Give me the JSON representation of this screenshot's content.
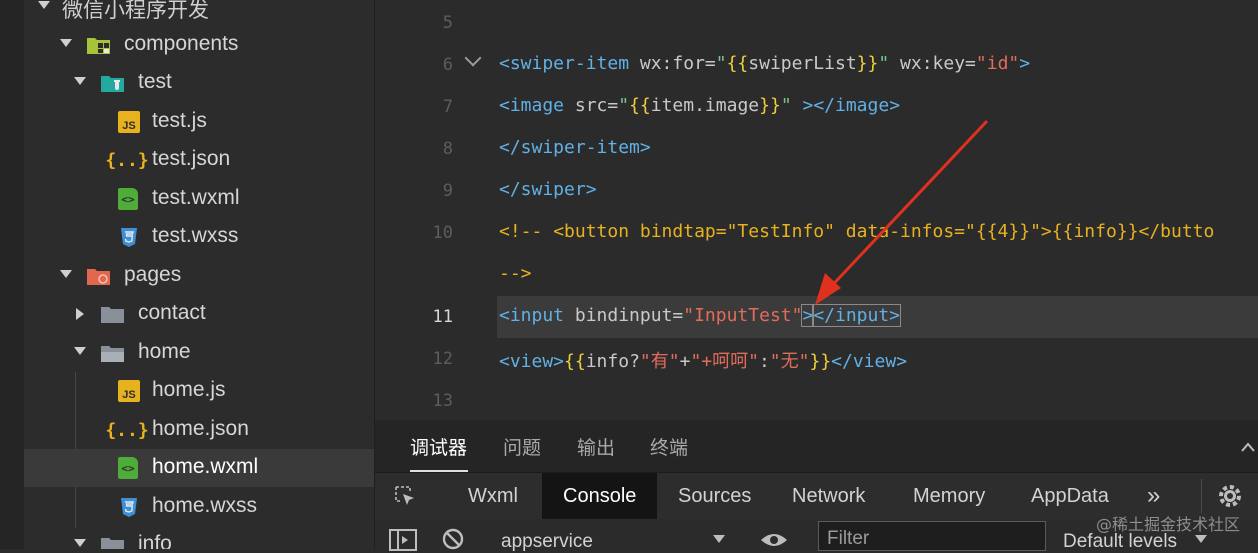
{
  "sidebar": {
    "root_label": "微信小程序开发",
    "items": [
      {
        "label": "components",
        "kind": "folder-components",
        "expanded": true
      },
      {
        "label": "test",
        "kind": "folder-test",
        "expanded": true
      },
      {
        "label": "test.js",
        "kind": "js"
      },
      {
        "label": "test.json",
        "kind": "json"
      },
      {
        "label": "test.wxml",
        "kind": "wxml"
      },
      {
        "label": "test.wxss",
        "kind": "wxss"
      },
      {
        "label": "pages",
        "kind": "folder-pages",
        "expanded": true
      },
      {
        "label": "contact",
        "kind": "folder",
        "expanded": false
      },
      {
        "label": "home",
        "kind": "folder",
        "expanded": true
      },
      {
        "label": "home.js",
        "kind": "js"
      },
      {
        "label": "home.json",
        "kind": "json"
      },
      {
        "label": "home.wxml",
        "kind": "wxml",
        "selected": true
      },
      {
        "label": "home.wxss",
        "kind": "wxss"
      },
      {
        "label": "info",
        "kind": "folder",
        "expanded": true
      }
    ],
    "icon_glyphs": {
      "js": "JS",
      "json": "{..}",
      "wxml": "<>"
    }
  },
  "editor": {
    "active_line": "11",
    "lines": [
      {
        "n": "5"
      },
      {
        "n": "6",
        "tag_open": "<swiper-item",
        "attr1": " wx:for=",
        "q": "\"",
        "b1": "{{",
        "v1": "swiperList",
        "b2": "}}",
        "attr2": " wx:key=",
        "v2": "\"id\"",
        "tag_close": ">"
      },
      {
        "n": "7",
        "tag_open": "<image",
        "attr1": " src=",
        "q": "\"",
        "b1": "{{",
        "v1": "item.image",
        "b2": "}}",
        "q2": "\"",
        "tag_close": " ></image>"
      },
      {
        "n": "8",
        "text": "</swiper-item>"
      },
      {
        "n": "9",
        "text": "</swiper>"
      },
      {
        "n": "10",
        "comment": "<!-- ",
        "tag_open": "<button",
        "attr1": " bindtap=",
        "v1": "\"TestInfo\"",
        "attr2": " data-infos=",
        "q": "\"",
        "b1": "{{",
        "v2": "4",
        "b2": "}}",
        "q2": "\"",
        "gt": ">",
        "b3": "{{",
        "v3": "info",
        "b4": "}}",
        "tag_close": "</butto"
      },
      {
        "n": "",
        "comment": "-->"
      },
      {
        "n": "11",
        "tag_open": "<input",
        "attr1": " bindinput=",
        "v1": "\"InputTest\"",
        "gt": ">",
        "tag_close": "</input>"
      },
      {
        "n": "12",
        "tag_open": "<view>",
        "b1": "{{",
        "v1": "info?",
        "s1": "\"有\"",
        "plus1": "+",
        "s2": "\"+呵呵\"",
        "colon": ":",
        "s3": "\"无\"",
        "b2": "}}",
        "tag_close": "</view>"
      },
      {
        "n": "13"
      }
    ]
  },
  "panel": {
    "tabs": [
      "调试器",
      "问题",
      "输出",
      "终端"
    ],
    "devtools_tabs": [
      "Wxml",
      "Console",
      "Sources",
      "Network",
      "Memory",
      "AppData"
    ],
    "more": "»",
    "context_select": "appservice",
    "filter_placeholder": "Filter",
    "levels": "Default levels"
  },
  "watermark": "@稀土掘金技术社区",
  "colors": {
    "tag": "#61b0e6",
    "string": "#7bc48e",
    "brace": "#f0cf3b",
    "expr": "#e26c5b",
    "comment": "#e8b21f",
    "annotation_arrow": "#e0301e"
  }
}
